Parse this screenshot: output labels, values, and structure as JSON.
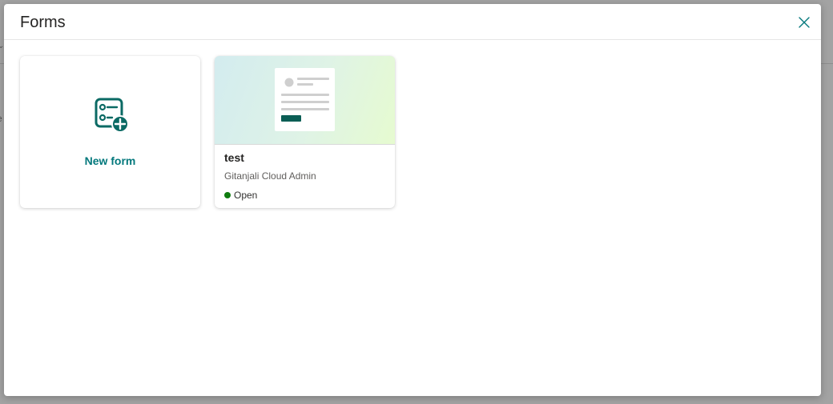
{
  "dialog": {
    "title": "Forms",
    "close_icon": "close-icon"
  },
  "new_form_card": {
    "label": "New form",
    "icon": "new-form-icon"
  },
  "form_cards": [
    {
      "title": "test",
      "owner": "Gitanjali Cloud Admin",
      "status": "Open",
      "status_color": "#107c10"
    }
  ],
  "colors": {
    "accent": "#03787c",
    "thumbnail_button": "#0b5e55"
  }
}
